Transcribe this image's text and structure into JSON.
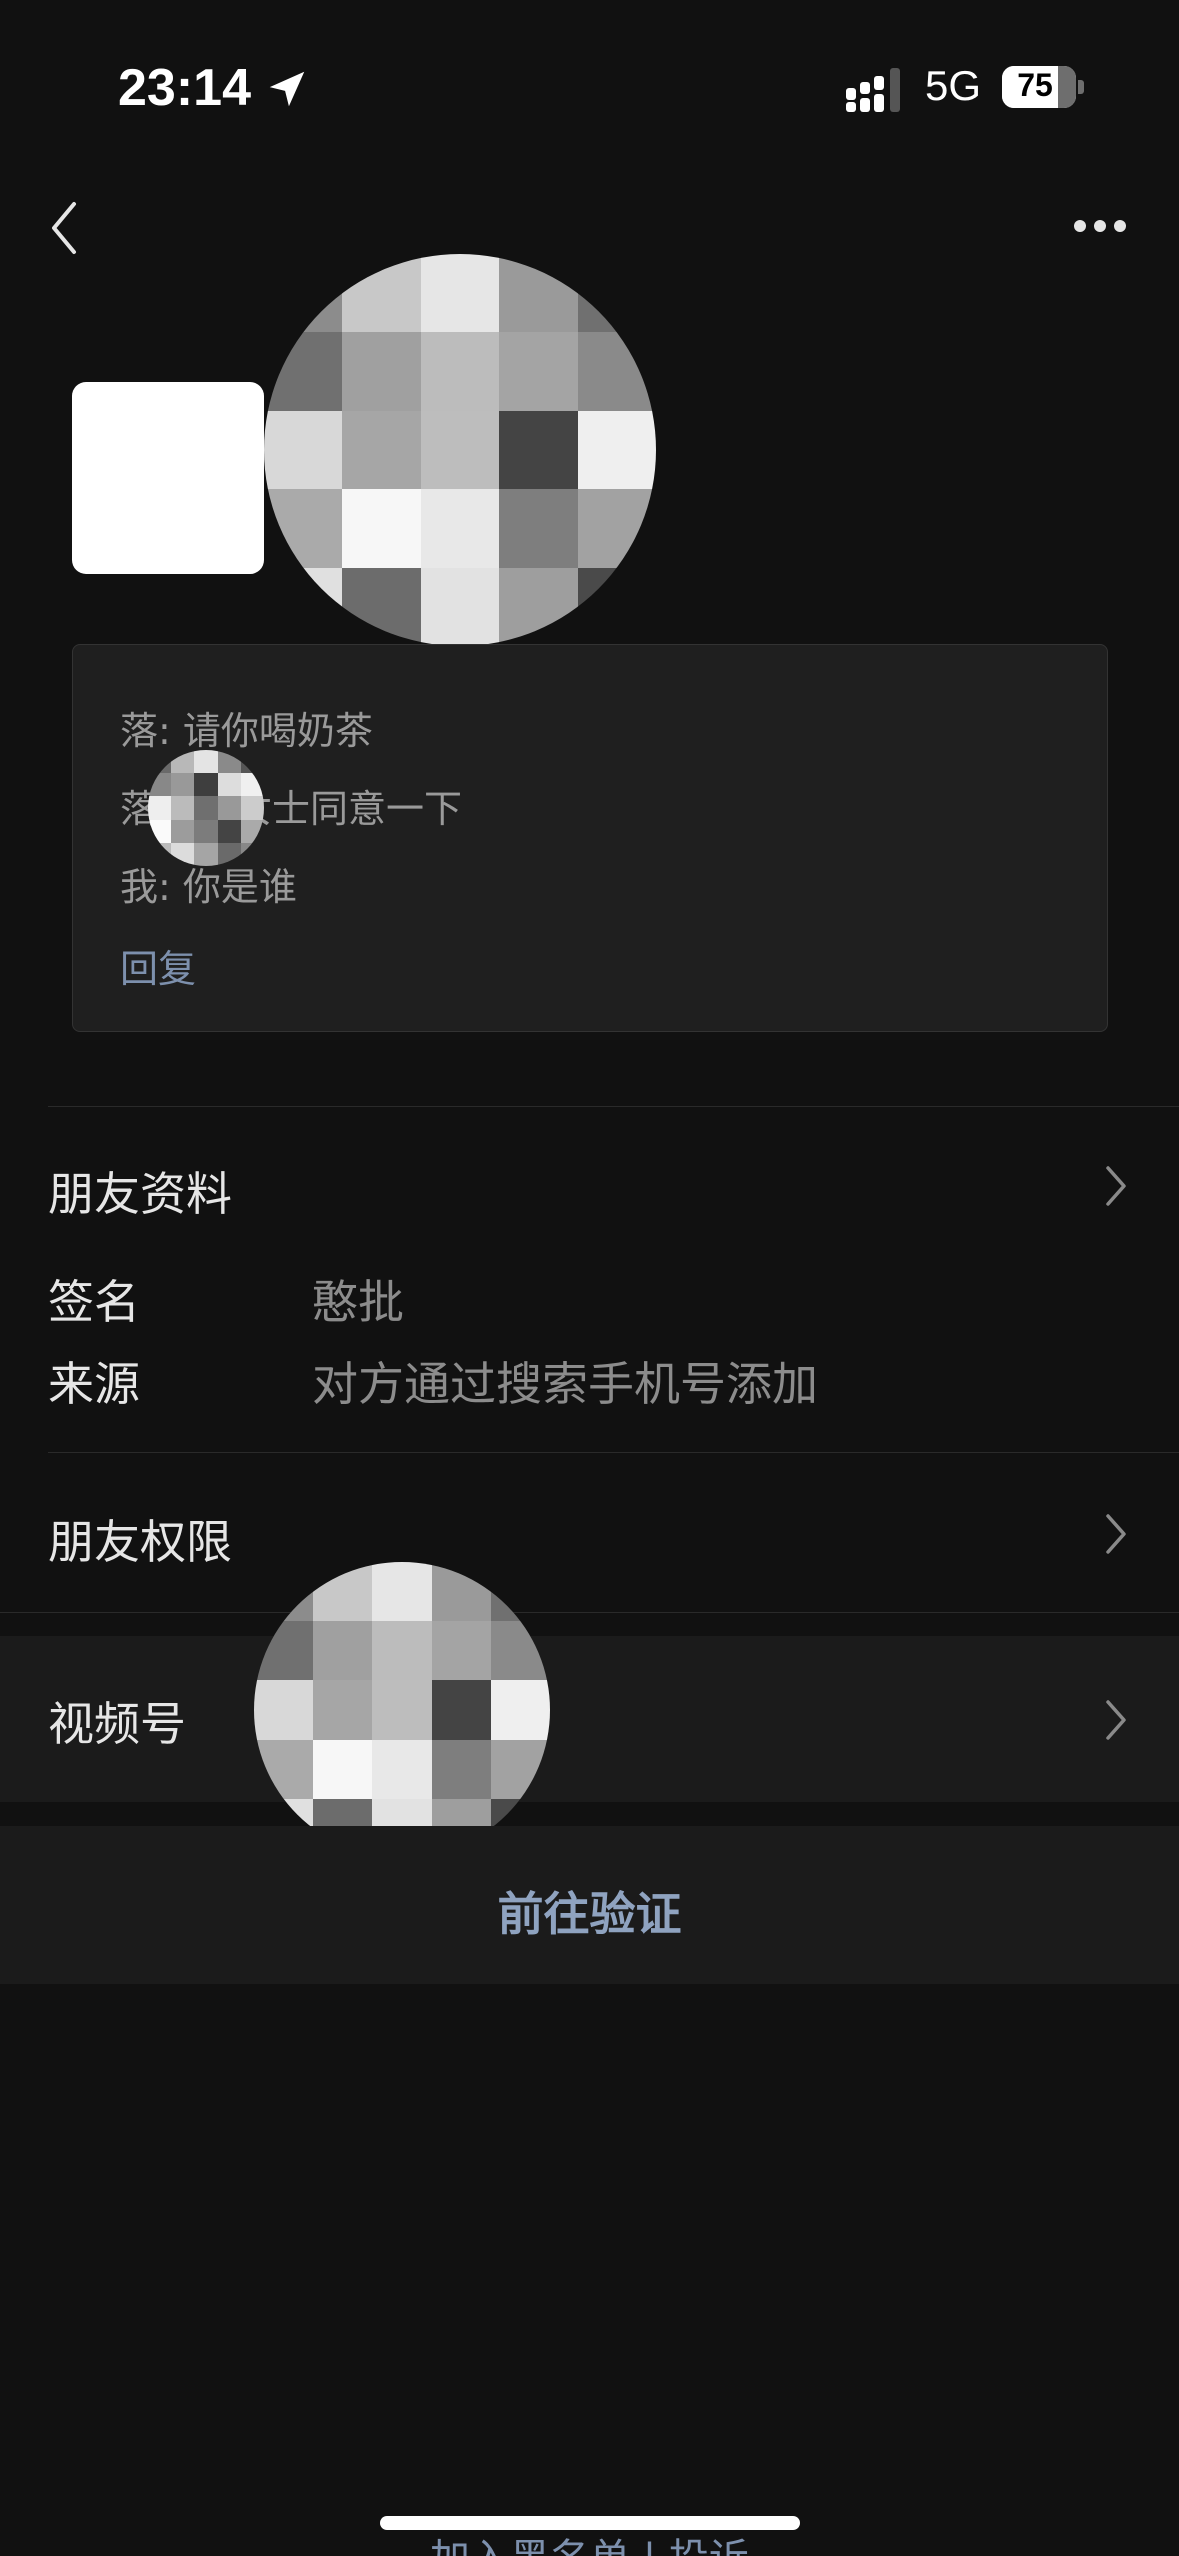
{
  "status_bar": {
    "time": "23:14",
    "network": "5G",
    "battery": "75",
    "battery_level": 0.75
  },
  "header": {
    "back_icon": "chevron-left-icon",
    "more_icon": "more-dots-icon"
  },
  "messages": [
    {
      "text": "落: 请你喝奶茶"
    },
    {
      "text": "落　　女士同意一下"
    },
    {
      "text": "我: 你是谁"
    }
  ],
  "reply_label": "回复",
  "friend_profile": {
    "title": "朋友资料",
    "signature_label": "签名",
    "signature_value": "憨批",
    "source_label": "来源",
    "source_value": "对方通过搜索手机号添加"
  },
  "friend_permissions": {
    "title": "朋友权限"
  },
  "channels": {
    "title": "视频号"
  },
  "verify_button": "前往验证",
  "bottom_actions": "加入黑名单 | 投诉",
  "colors": {
    "background": "#111111",
    "accent": "#8fa3c0"
  }
}
